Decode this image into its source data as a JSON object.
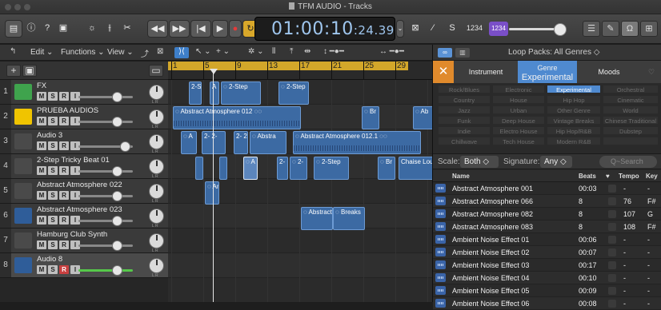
{
  "window": {
    "title": "TFM AUDIO - Tracks"
  },
  "lcd": {
    "time_main": "01:00:10",
    "time_frames": ":24.39"
  },
  "control": {
    "tempo_badge": "1234"
  },
  "track_toolbar": {
    "edit": "Edit ⌄",
    "functions": "Functions ⌄",
    "view": "View ⌄"
  },
  "ruler": {
    "bars": [
      "1",
      "5",
      "9",
      "13",
      "17",
      "21",
      "25",
      "29"
    ]
  },
  "tracks": [
    {
      "num": "1",
      "name": "FX",
      "icon_color": "#3fa34d",
      "icon": "music-note-icon"
    },
    {
      "num": "2",
      "name": "PRUEBA AUDIOS",
      "icon_color": "#f0c400",
      "icon": "metronome-icon"
    },
    {
      "num": "3",
      "name": "Audio 3",
      "icon_color": "#4a4a4a",
      "icon": "waveform-icon"
    },
    {
      "num": "4",
      "name": "2-Step Tricky Beat 01",
      "icon_color": "#4a4a4a",
      "icon": "waveform-icon"
    },
    {
      "num": "5",
      "name": "Abstract Atmosphere 022",
      "icon_color": "#4a4a4a",
      "icon": "speaker-icon"
    },
    {
      "num": "6",
      "name": "Abstract Atmosphere 023",
      "icon_color": "#2f5d99",
      "icon": "waveform-icon"
    },
    {
      "num": "7",
      "name": "Hamburg Club Synth",
      "icon_color": "#4a4a4a",
      "icon": "keyboard-icon"
    },
    {
      "num": "8",
      "name": "Audio 8",
      "icon_color": "#2f5d99",
      "icon": "waveform-icon"
    }
  ],
  "regions": {
    "r1a": "2-S",
    "r1b": "A",
    "r1c": "◌ 2-Step",
    "r1d": "◌ 2-Step",
    "r2a": "◌ Abstract Atmosphere 012 ◌◌",
    "r2b": "◌ Br",
    "r2c": "◌ Ab",
    "r3a": "◌ A",
    "r3b": "2- 2-",
    "r3c": "2- 2-",
    "r3d": "◌ Abstra",
    "r3e": "◌ Abstract Atmosphere 012.1 ◌◌",
    "r4a": "◌ A",
    "r4b": "2-",
    "r4c": "◌ 2-",
    "r4d": "◌ 2-Step",
    "r4e": "◌ Br",
    "r4f": "Chaise Lou",
    "r5a": "◌ An",
    "r6a": "◌ Abstract",
    "r6b": "◌ Breaks"
  },
  "loops": {
    "packs_label": "Loop Packs:  All Genres ◇",
    "tabs": {
      "instrument": "Instrument",
      "genre_small": "Genre",
      "genre": "Experimental",
      "moods": "Moods"
    },
    "keywords": [
      [
        "Rock/Blues",
        "Electronic",
        "Experimental",
        "Orchestral"
      ],
      [
        "Country",
        "House",
        "Hip Hop",
        "Cinematic"
      ],
      [
        "Jazz",
        "Urban",
        "Other Genre",
        "World"
      ],
      [
        "Funk",
        "Deep House",
        "Vintage Breaks",
        "Chinese Traditional"
      ],
      [
        "Indie",
        "Electro House",
        "Hip Hop/R&B",
        "Dubstep"
      ],
      [
        "Chillwave",
        "Tech House",
        "Modern R&B",
        ""
      ]
    ],
    "filter": {
      "scale_label": "Scale:",
      "scale_value": "Both",
      "signature_label": "Signature:",
      "signature_value": "Any",
      "search_placeholder": "Q~Search"
    },
    "columns": {
      "name": "Name",
      "beats": "Beats",
      "fav": "♥",
      "tempo": "Tempo",
      "key": "Key"
    },
    "results": [
      {
        "name": "Abstract Atmosphere 001",
        "beats": "00:03",
        "tempo": "-",
        "key": "-"
      },
      {
        "name": "Abstract Atmosphere 066",
        "beats": "8",
        "tempo": "76",
        "key": "F#"
      },
      {
        "name": "Abstract Atmosphere 082",
        "beats": "8",
        "tempo": "107",
        "key": "G"
      },
      {
        "name": "Abstract Atmosphere 083",
        "beats": "8",
        "tempo": "108",
        "key": "F#"
      },
      {
        "name": "Ambient Noise Effect 01",
        "beats": "00:06",
        "tempo": "-",
        "key": "-"
      },
      {
        "name": "Ambient Noise Effect 02",
        "beats": "00:07",
        "tempo": "-",
        "key": "-"
      },
      {
        "name": "Ambient Noise Effect 03",
        "beats": "00:17",
        "tempo": "-",
        "key": "-"
      },
      {
        "name": "Ambient Noise Effect 04",
        "beats": "00:10",
        "tempo": "-",
        "key": "-"
      },
      {
        "name": "Ambient Noise Effect 05",
        "beats": "00:09",
        "tempo": "-",
        "key": "-"
      },
      {
        "name": "Ambient Noise Effect 06",
        "beats": "00:08",
        "tempo": "-",
        "key": "-"
      }
    ]
  }
}
